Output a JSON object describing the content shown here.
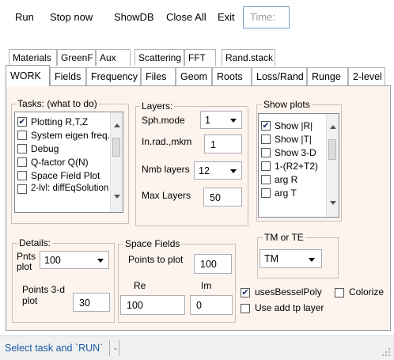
{
  "menu": {
    "run": "Run",
    "stop_now": "Stop now",
    "showdb": "ShowDB",
    "close_all": "Close All",
    "exit": "Exit",
    "time_placeholder": "Time:"
  },
  "tabs_row1": [
    "Materials",
    "GreenF",
    "Aux",
    "Scattering",
    "FFT",
    "Rand.stack"
  ],
  "tabs_row2": [
    "WORK",
    "Fields",
    "Frequency",
    "Files",
    "Geom",
    "Roots",
    "Loss/Rand",
    "Runge",
    "2-level"
  ],
  "active_tab": "WORK",
  "tasks": {
    "title": "Tasks:  (what to do)",
    "items": [
      {
        "label": "Plotting R,T,Z",
        "checked": true
      },
      {
        "label": "System  eigen freq.",
        "checked": false
      },
      {
        "label": "Debug",
        "checked": false
      },
      {
        "label": "Q-factor Q(N)",
        "checked": false
      },
      {
        "label": "Space Field Plot",
        "checked": false
      },
      {
        "label": "2-lvl: diffEqSolution",
        "checked": false
      }
    ]
  },
  "layers": {
    "title": "Layers:",
    "sph_mode_label": "Sph.mode",
    "sph_mode_value": "1",
    "in_rad_label": "In.rad.,mkm",
    "in_rad_value": "1",
    "nmb_layers_label": "Nmb layers",
    "nmb_layers_value": "12",
    "max_layers_label": "Max Layers",
    "max_layers_value": "50"
  },
  "show_plots": {
    "title": "Show plots",
    "items": [
      {
        "label": "Show |R|",
        "checked": true
      },
      {
        "label": "Show |T|",
        "checked": false
      },
      {
        "label": "Show 3-D",
        "checked": false
      },
      {
        "label": "1-(R2+T2)",
        "checked": false
      },
      {
        "label": "arg R",
        "checked": false
      },
      {
        "label": "arg T",
        "checked": false
      }
    ]
  },
  "details": {
    "title": "Details:",
    "pnts_plot_label": "Pnts plot",
    "pnts_plot_value": "100",
    "points3d_label": "Points 3-d plot",
    "points3d_value": "30"
  },
  "space_fields": {
    "title": "Space Fields",
    "points_to_plot_label": "Points to plot",
    "points_to_plot_value": "100",
    "re_label": "Re",
    "re_value": "100",
    "im_label": "Im",
    "im_value": "0"
  },
  "tm_te": {
    "title": "TM or TE",
    "value": "TM"
  },
  "options": {
    "uses_bessel_label": "usesBesselPoly",
    "uses_bessel_checked": true,
    "use_add_label": "Use add tp layer",
    "use_add_checked": false,
    "colorize_label": "Colorize",
    "colorize_checked": false
  },
  "status": {
    "message": "Select task and `RUN`",
    "extra": "-"
  }
}
